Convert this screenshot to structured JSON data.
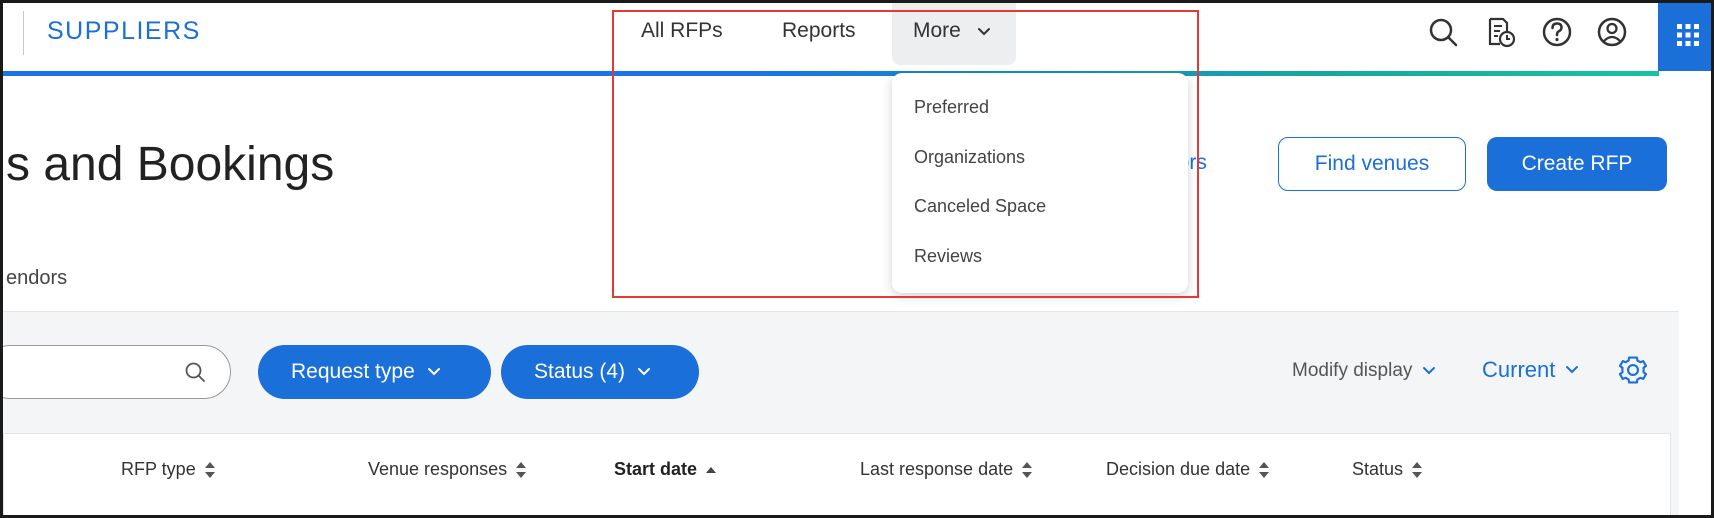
{
  "header": {
    "brand": "SUPPLIERS",
    "nav": {
      "all_rfps": "All RFPs",
      "reports": "Reports",
      "more": "More"
    },
    "icons": [
      "search-icon",
      "document-clock-icon",
      "help-icon",
      "account-icon",
      "apps-grid-icon"
    ]
  },
  "more_menu": {
    "items": [
      "Preferred",
      "Organizations",
      "Canceled Space",
      "Reviews"
    ]
  },
  "page": {
    "title": "s and Bookings",
    "partial_link": "lors",
    "find_venues": "Find venues",
    "create_rfp": "Create RFP",
    "tab_vendors": "endors"
  },
  "filters": {
    "request_type": "Request type",
    "status": "Status (4)",
    "modify_display": "Modify display",
    "current": "Current"
  },
  "table": {
    "columns": [
      "RFP type",
      "Venue responses",
      "Start date",
      "Last response date",
      "Decision due date",
      "Status"
    ],
    "sorted_column": "Start date"
  },
  "colors": {
    "accent": "#1a6fd8",
    "highlight": "#e53935",
    "filter_band": "#f4f5f7"
  }
}
